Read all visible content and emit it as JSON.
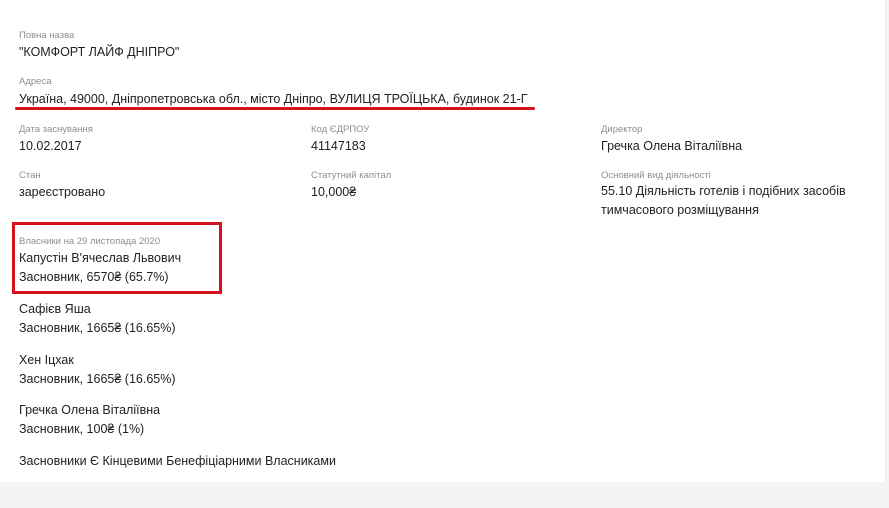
{
  "full_name": {
    "label": "Повна назва",
    "value": "\"КОМФОРТ ЛАЙФ ДНІПРО\""
  },
  "address": {
    "label": "Адреса",
    "value": "Україна, 49000, Дніпропетровська обл., місто Дніпро, ВУЛИЦЯ ТРОЇЦЬКА, будинок 21-Г"
  },
  "founded": {
    "label": "Дата заснування",
    "value": "10.02.2017"
  },
  "edrpou": {
    "label": "Код ЄДРПОУ",
    "value": "41147183"
  },
  "director": {
    "label": "Директор",
    "value": "Гречка Олена Віталіївна"
  },
  "status": {
    "label": "Стан",
    "value": "зареєстровано"
  },
  "capital": {
    "label": "Статутний капітал",
    "value": "10,000₴"
  },
  "activity": {
    "label": "Основний вид діяльності",
    "value": "55.10 Діяльність готелів і подібних засобів тимчасового розміщування"
  },
  "owners": {
    "label": "Власники на 29 листопада 2020",
    "items": [
      {
        "name": "Капустін В'ячеслав Львович",
        "share": "Засновник, 6570₴ (65.7%)"
      },
      {
        "name": "Сафієв Яша",
        "share": "Засновник, 1665₴ (16.65%)"
      },
      {
        "name": "Хен Іцхак",
        "share": "Засновник, 1665₴ (16.65%)"
      },
      {
        "name": "Гречка Олена Віталіївна",
        "share": "Засновник, 100₴ (1%)"
      }
    ],
    "note": "Засновники Є Кінцевими Бенефіціарними Власниками"
  },
  "colors": {
    "highlight": "#d7121f",
    "label": "#8a8f96",
    "text": "#222222"
  }
}
